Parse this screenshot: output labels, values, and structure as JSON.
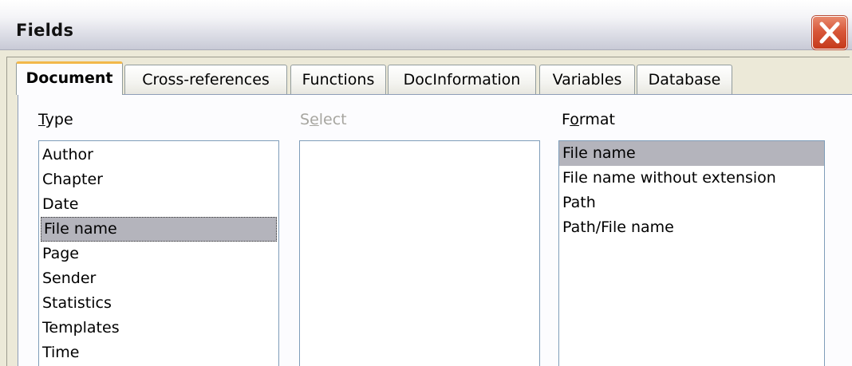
{
  "window": {
    "title": "Fields"
  },
  "tabs": [
    {
      "label": "Document",
      "active": true
    },
    {
      "label": "Cross-references",
      "active": false
    },
    {
      "label": "Functions",
      "active": false
    },
    {
      "label": "DocInformation",
      "active": false
    },
    {
      "label": "Variables",
      "active": false
    },
    {
      "label": "Database",
      "active": false
    }
  ],
  "type_column": {
    "label_mnemonic": "T",
    "label_rest": "ype",
    "items": [
      "Author",
      "Chapter",
      "Date",
      "File name",
      "Page",
      "Sender",
      "Statistics",
      "Templates",
      "Time"
    ],
    "selected": "File name"
  },
  "select_column": {
    "label_first": "S",
    "label_mnemonic": "e",
    "label_rest": "lect",
    "enabled": false,
    "items": []
  },
  "format_column": {
    "label_first": "F",
    "label_mnemonic": "o",
    "label_rest": "rmat",
    "items": [
      "File name",
      "File name without extension",
      "Path",
      "Path/File name"
    ],
    "selected": "File name"
  },
  "colors": {
    "selection": "#b4b4bc",
    "close_button": "#d8583a",
    "active_tab_accent": "#f2b84a"
  }
}
